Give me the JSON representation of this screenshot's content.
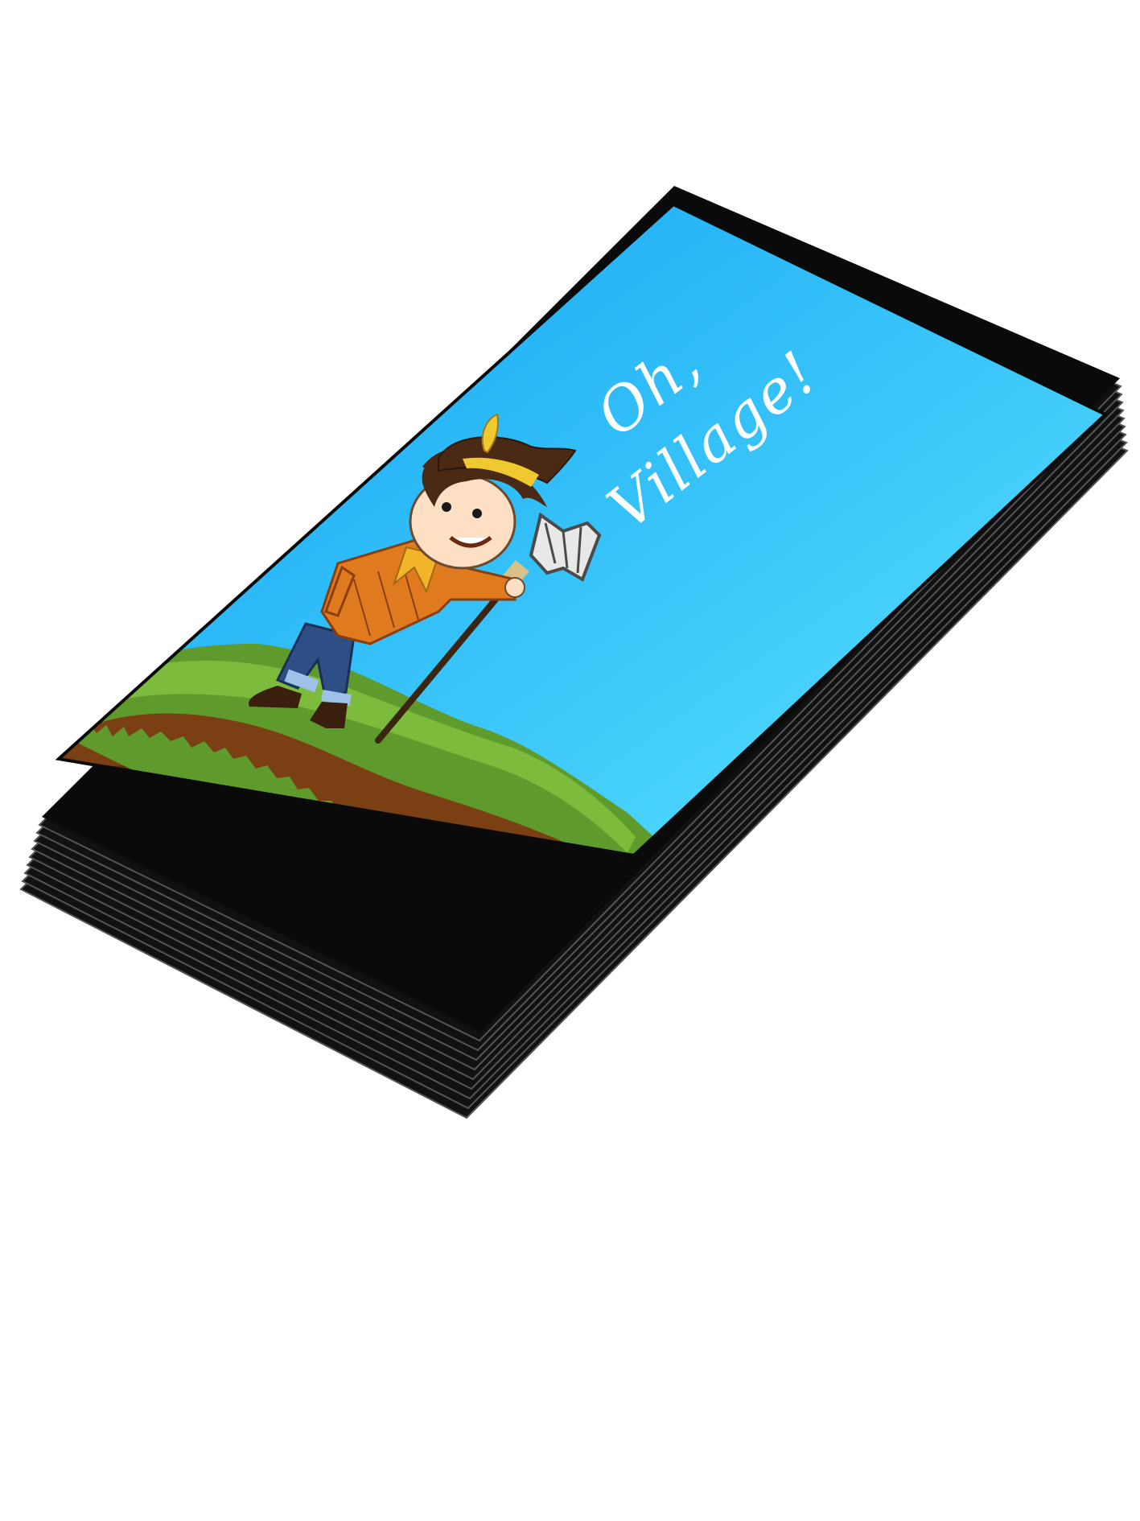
{
  "card": {
    "title_line1": "Oh,",
    "title_line2": "Village!",
    "stack_count": 10
  },
  "colors": {
    "border": "#0a0a0a",
    "sky_top": "#0aa0f5",
    "sky_bottom": "#5ee6ff",
    "grass": "#5f9a2c",
    "grass_light": "#7cbb3c",
    "soil": "#7a3f12",
    "soil_dark": "#4a230a",
    "shirt": "#e07a1e",
    "jeans": "#2e4f86",
    "hat": "#4a2a14",
    "hat_band": "#f0c830",
    "title_text": "#ffffff"
  },
  "icons": {
    "character": "farmer-boy-icon",
    "tool": "pitchfork-icon",
    "feather": "feather-icon"
  }
}
